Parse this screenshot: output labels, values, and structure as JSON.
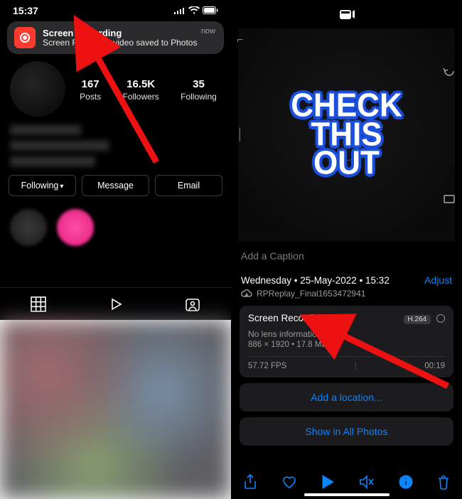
{
  "left": {
    "statusbar_time": "15:37",
    "notification": {
      "title": "Screen Recording",
      "body": "Screen Recording video saved to Photos",
      "time": "now"
    },
    "stats": {
      "posts_num": "167",
      "posts_lbl": "Posts",
      "followers_num": "16.5K",
      "followers_lbl": "Followers",
      "following_num": "35",
      "following_lbl": "Following"
    },
    "buttons": {
      "following": "Following",
      "message": "Message",
      "email": "Email"
    }
  },
  "right": {
    "preview_text": "CHECK\nTHIS\nOUT",
    "caption_placeholder": "Add a Caption",
    "meta": {
      "dateline": "Wednesday • 25-May-2022 • 15:32",
      "adjust": "Adjust",
      "filename": "RPReplay_Final1653472941"
    },
    "card": {
      "title": "Screen Recording",
      "codec": "H.264",
      "lens": "No lens information",
      "details": "886 × 1920 • 17.8 MB",
      "fps": "57.72 FPS",
      "duration": "00:19"
    },
    "add_location": "Add a location...",
    "show_all": "Show in All Photos"
  }
}
